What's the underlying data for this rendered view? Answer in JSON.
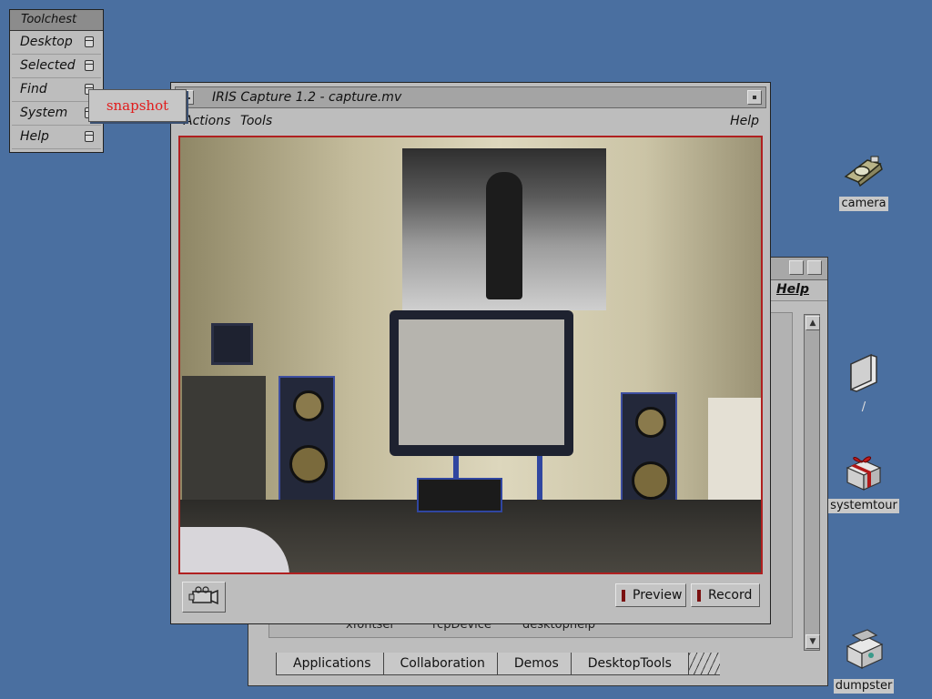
{
  "toolchest": {
    "title": "Toolchest",
    "items": [
      {
        "label": "Desktop"
      },
      {
        "label": "Selected"
      },
      {
        "label": "Find"
      },
      {
        "label": "System"
      },
      {
        "label": "Help"
      }
    ],
    "popup_item": "snapshot"
  },
  "capture_window": {
    "title": "IRIS Capture 1.2 - capture.mv",
    "menu": {
      "actions": "Actions",
      "tools": "Tools",
      "help": "Help"
    },
    "buttons": {
      "preview": "Preview",
      "record": "Record"
    }
  },
  "background_window": {
    "help": "Help",
    "items": [
      "xfontsel",
      "rcpDevice",
      "desktophelp"
    ],
    "tabs": [
      "Applications",
      "Collaboration",
      "Demos",
      "DesktopTools"
    ]
  },
  "desktop_icons": [
    {
      "label": "camera"
    },
    {
      "label": "/"
    },
    {
      "label": "systemtour"
    },
    {
      "label": "dumpster"
    }
  ]
}
